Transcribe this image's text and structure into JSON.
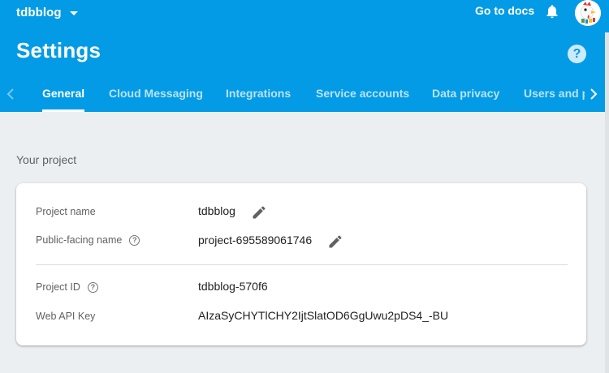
{
  "header": {
    "project_switcher": "tdbblog",
    "docs_link": "Go to docs",
    "page_title": "Settings",
    "help_symbol": "?",
    "bg_color": "#039be5"
  },
  "tabs": [
    {
      "label": "General",
      "active": true
    },
    {
      "label": "Cloud Messaging",
      "active": false
    },
    {
      "label": "Integrations",
      "active": false
    },
    {
      "label": "Service accounts",
      "active": false
    },
    {
      "label": "Data privacy",
      "active": false
    },
    {
      "label": "Users and permissions",
      "active": false
    }
  ],
  "main": {
    "section_title": "Your project",
    "fields": {
      "project_name": {
        "label": "Project name",
        "value": "tdbblog"
      },
      "public_name": {
        "label": "Public-facing name",
        "value": "project-695589061746"
      },
      "project_id": {
        "label": "Project ID",
        "value": "tdbblog-570f6"
      },
      "web_api_key": {
        "label": "Web API Key",
        "value": "AIzaSyCHYTlCHY2IjtSlatOD6GgUwu2pDS4_-BU"
      }
    },
    "help_symbol": "?"
  },
  "icons": {
    "bell": "bell-icon",
    "edit": "pencil-icon",
    "help": "help-circle-icon",
    "chevron_left": "chevron-left-icon",
    "chevron_right": "chevron-right-icon",
    "dropdown": "caret-down-icon"
  }
}
